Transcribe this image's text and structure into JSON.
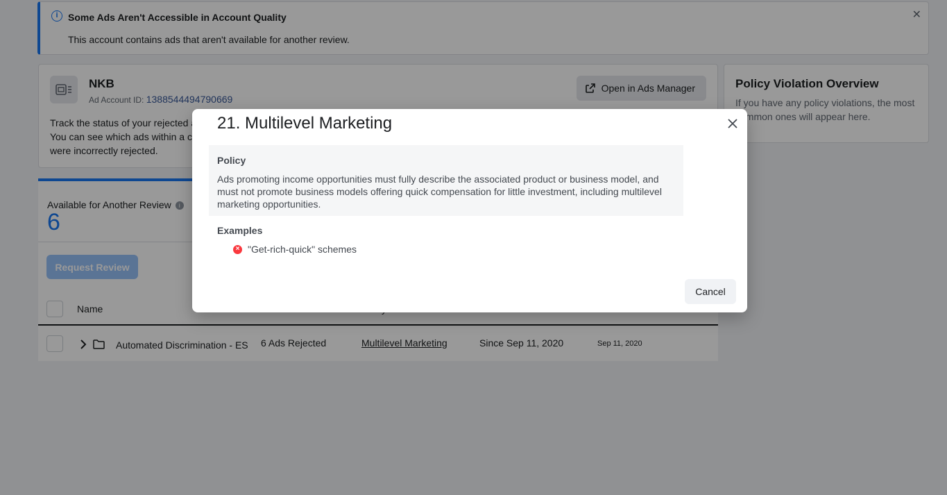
{
  "banner": {
    "title": "Some Ads Aren't Accessible in Account Quality",
    "text": "This account contains ads that aren't available for another review.",
    "close_glyph": "✕"
  },
  "account": {
    "name": "NKB",
    "id_label": "Ad Account ID:",
    "id_value": "1388544494790669",
    "desc_line1": "Track the status of your rejected a",
    "desc_line2": "You can see which ads within a c",
    "desc_line3": "were incorrectly rejected.",
    "open_label": "Open in Ads Manager"
  },
  "policy_overview": {
    "title": "Policy Violation Overview",
    "text": "If you have any policy violations, the most common ones will appear here."
  },
  "review": {
    "label": "Available for Another Review",
    "info_glyph": "i",
    "count": "6",
    "request_label": "Request Review",
    "column_name": "Name",
    "column_hidden": "y"
  },
  "table_rows": [
    {
      "name": "Automated Discrimination - ES",
      "ads": "6 Ads Rejected",
      "policy": "Multilevel Marketing",
      "since": "Since Sep 11, 2020",
      "date": "Sep 11, 2020"
    }
  ],
  "modal": {
    "title": "21. Multilevel Marketing",
    "policy_title": "Policy",
    "policy_text": "Ads promoting income opportunities must fully describe the associated product or business model, and must not promote business models offering quick compensation for little investment, including multilevel marketing opportunities.",
    "examples_title": "Examples",
    "example_1": "\"Get-rich-quick\" schemes",
    "cancel_label": "Cancel"
  },
  "colors": {
    "accent": "#1877f2",
    "error": "#fa383e"
  }
}
